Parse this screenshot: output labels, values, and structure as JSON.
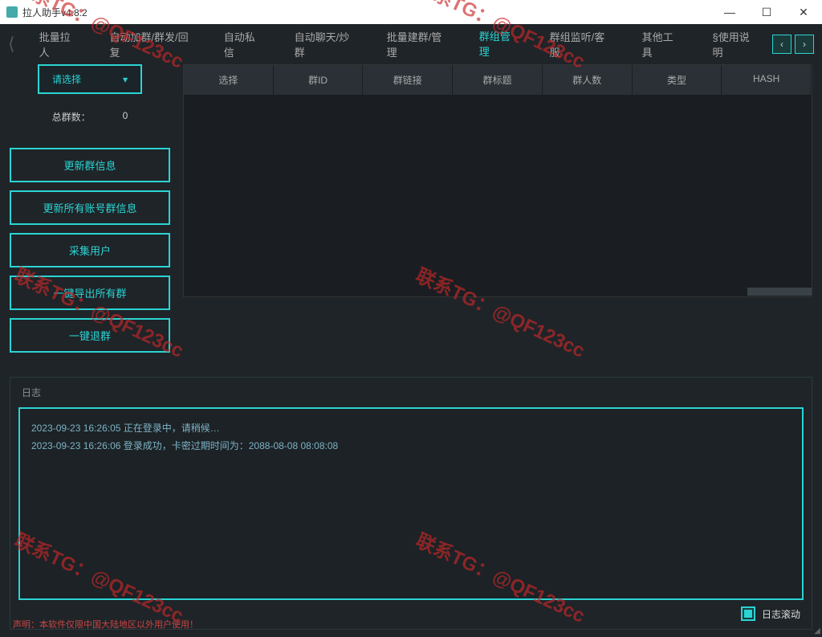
{
  "window": {
    "title": "拉人助手v4.8.2"
  },
  "tabs": {
    "items": [
      "批量拉人",
      "自动加群/群发/回复",
      "自动私信",
      "自动聊天/炒群",
      "批量建群/管理",
      "群组管理",
      "群组监听/客服",
      "其他工具",
      "§使用说明"
    ],
    "active_index": 5
  },
  "sidebar": {
    "select_label": "请选择",
    "count_label": "总群数：",
    "count_value": "0",
    "buttons": [
      "更新群信息",
      "更新所有账号群信息",
      "采集用户",
      "一键导出所有群",
      "一键退群"
    ]
  },
  "table": {
    "headers": [
      "选择",
      "群ID",
      "群链接",
      "群标题",
      "群人数",
      "类型",
      "HASH"
    ]
  },
  "log": {
    "title": "日志",
    "lines": [
      "2023-09-23 16:26:05 正在登录中，请稍候…",
      "2023-09-23 16:26:06 登录成功，卡密过期时间为：2088-08-08 08:08:08"
    ],
    "scroll_label": "日志滚动",
    "scroll_checked": true
  },
  "disclaimer": "声明：本软件仅限中国大陆地区以外用户使用！",
  "watermark": "联系TG：@QF123cc"
}
